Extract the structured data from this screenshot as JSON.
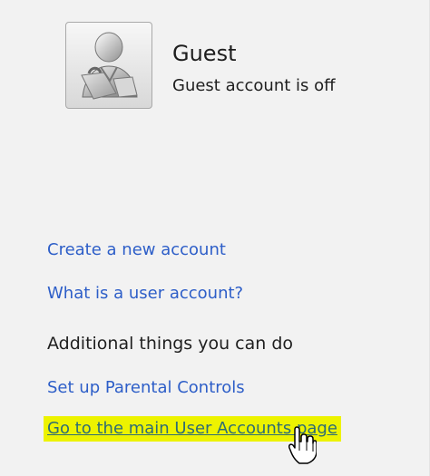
{
  "account": {
    "avatar_icon": "user-avatar-icon",
    "name": "Guest",
    "status": "Guest account is off"
  },
  "links": {
    "create_account": "Create a new account",
    "what_is_account": "What is a user account?"
  },
  "additional": {
    "heading": "Additional things you can do",
    "parental_controls": "Set up Parental Controls",
    "main_user_accounts": "Go to the main User Accounts page"
  },
  "pointer_icon": "hand-cursor-icon",
  "colors": {
    "link": "#2d5ec8",
    "highlight": "#edf300",
    "highlighted_link": "#2d6c75"
  }
}
